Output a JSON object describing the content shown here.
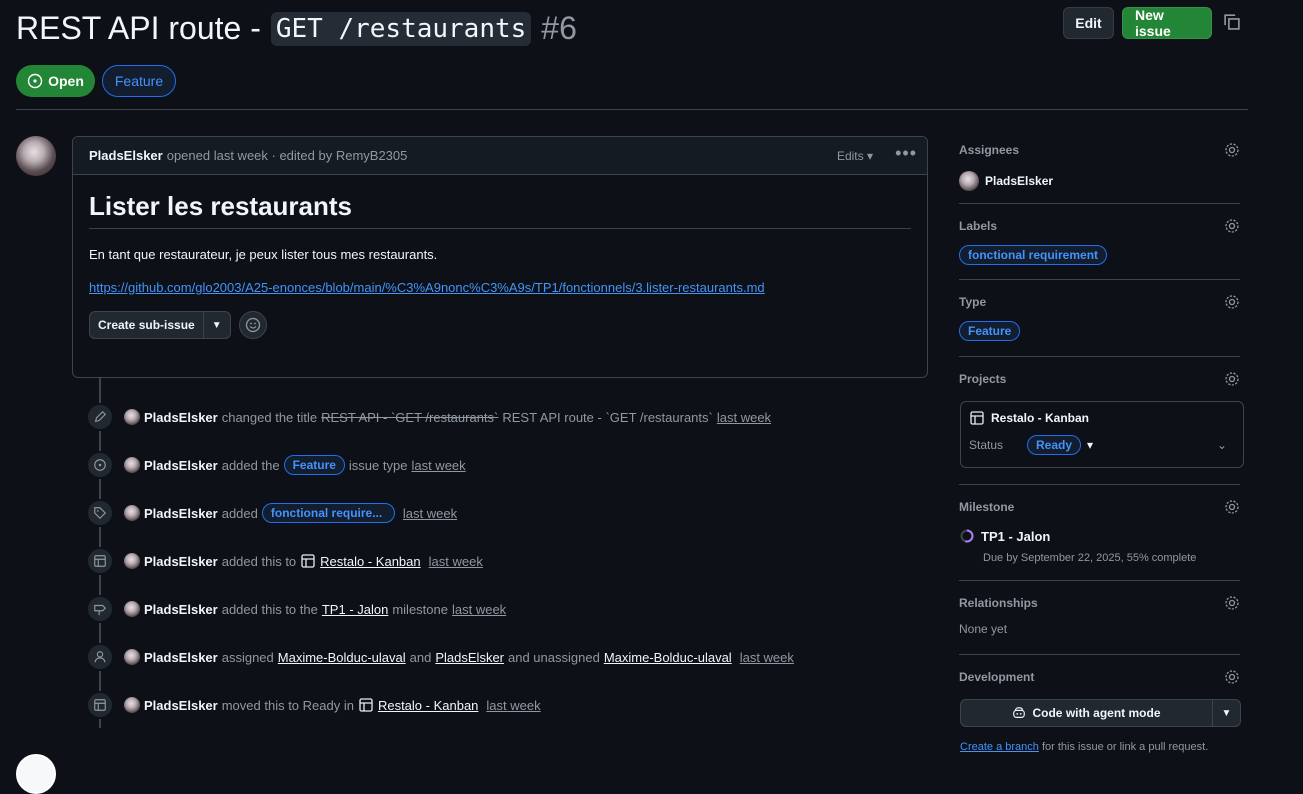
{
  "issue": {
    "title_prefix": "REST API route -",
    "title_code": "GET /restaurants",
    "number": "#6",
    "status": "Open",
    "type_badge": "Feature",
    "edit_label": "Edit",
    "new_issue_label": "New issue"
  },
  "comment": {
    "author": "PladsElsker",
    "meta": "opened last week · edited by RemyB2305",
    "edits_label": "Edits",
    "heading": "Lister les restaurants",
    "body": "En tant que restaurateur, je peux lister tous mes restaurants.",
    "link": "https://github.com/glo2003/A25-enonces/blob/main/%C3%A9nonc%C3%A9s/TP1/fonctionnels/3.lister-restaurants.md",
    "sub_issue_label": "Create sub-issue"
  },
  "timeline": [
    {
      "icon": "pencil-icon",
      "user": "PladsElsker",
      "pre": "changed the title",
      "old": "REST API - `GET /restaurants`",
      "new": "REST API route - `GET /restaurants`",
      "time": "last week"
    },
    {
      "icon": "issue-type-icon",
      "user": "PladsElsker",
      "pre": "added the",
      "pill": "Feature",
      "post": "issue type",
      "time": "last week"
    },
    {
      "icon": "tag-icon",
      "user": "PladsElsker",
      "pre": "added",
      "pill": "fonctional require...",
      "time": "last week"
    },
    {
      "icon": "table-icon",
      "user": "PladsElsker",
      "pre": "added this to",
      "link": "Restalo - Kanban",
      "time": "last week"
    },
    {
      "icon": "milestone-icon",
      "user": "PladsElsker",
      "pre": "added this to the",
      "link": "TP1 - Jalon",
      "post": "milestone",
      "time": "last week"
    },
    {
      "icon": "person-icon",
      "user": "PladsElsker",
      "pre": "assigned",
      "link": "Maxime-Bolduc-ulaval",
      "mid": "and",
      "link2": "PladsElsker",
      "mid2": "and unassigned",
      "link3": "Maxime-Bolduc-ulaval",
      "time": "last week"
    },
    {
      "icon": "table-icon",
      "user": "PladsElsker",
      "pre": "moved this to Ready in",
      "link": "Restalo - Kanban",
      "time": "last week"
    }
  ],
  "sidebar": {
    "assignees": {
      "label": "Assignees",
      "value": "PladsElsker"
    },
    "labels": {
      "label": "Labels",
      "value": "fonctional requirement"
    },
    "type": {
      "label": "Type",
      "value": "Feature"
    },
    "projects": {
      "label": "Projects",
      "project": "Restalo - Kanban",
      "status_label": "Status",
      "status_value": "Ready"
    },
    "milestone": {
      "label": "Milestone",
      "name": "TP1 - Jalon",
      "due": "Due by September 22, 2025, 55% complete"
    },
    "relationships": {
      "label": "Relationships",
      "value": "None yet"
    },
    "development": {
      "label": "Development",
      "agent_label": "Code with agent mode",
      "branch_link": "Create a branch",
      "branch_text": "for this issue or link a pull request."
    }
  },
  "colors": {
    "bg": "#0d1117",
    "accent": "#4493f8",
    "green": "#238636",
    "border": "#3d444d"
  }
}
